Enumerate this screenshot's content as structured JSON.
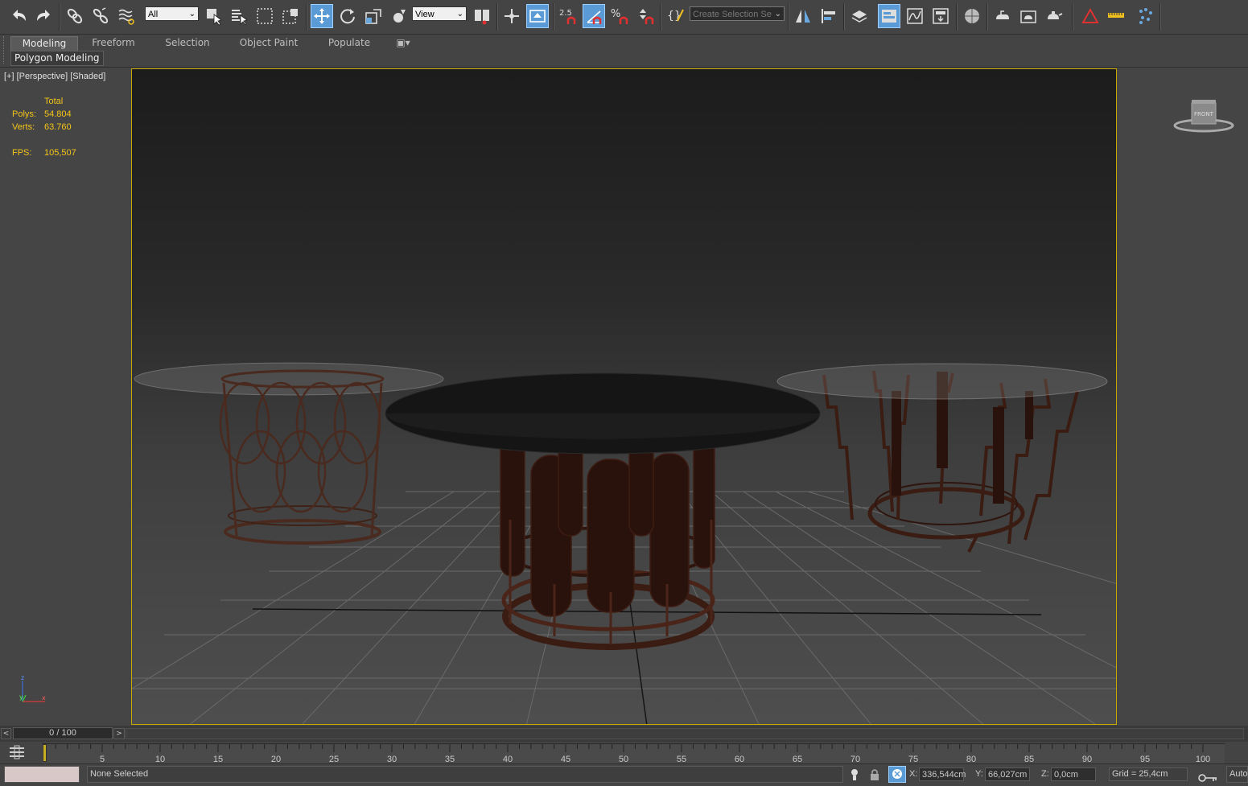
{
  "toolbar": {
    "filter_dropdown": "All",
    "coord_dropdown": "View",
    "snap_label": "2.5",
    "selection_set_placeholder": "Create Selection Se",
    "icons": [
      "undo-icon",
      "redo-icon",
      "link-icon",
      "unlink-icon",
      "bind-spacewarp-icon",
      "select-object-icon",
      "select-by-name-icon",
      "rect-select-icon",
      "window-crossing-icon",
      "move-icon",
      "rotate-icon",
      "scale-icon",
      "place-icon",
      "use-pivot-icon",
      "select-manipulate-icon",
      "keyboard-shortcut-icon",
      "snap-toggle-icon",
      "angle-snap-icon",
      "percent-snap-icon",
      "spinner-snap-icon",
      "edit-named-sets-icon",
      "mirror-icon",
      "align-icon",
      "scene-explorer-icon",
      "layer-explorer-icon",
      "curve-editor-icon",
      "schematic-view-icon",
      "material-editor-icon",
      "render-setup-icon",
      "rendered-frame-icon",
      "render-icon",
      "ruler-icon",
      "civil-view-icon",
      "particle-icon"
    ],
    "accent_color": "#5b9bd5"
  },
  "ribbon": {
    "tabs": [
      "Modeling",
      "Freeform",
      "Selection",
      "Object Paint",
      "Populate"
    ],
    "active_tab": "Modeling",
    "sub_label": "Polygon Modeling"
  },
  "viewport": {
    "label": "[+] [Perspective] [Shaded]",
    "stats": {
      "header": "Total",
      "polys_label": "Polys:",
      "polys_value": "54.804",
      "verts_label": "Verts:",
      "verts_value": "63.760",
      "fps_label": "FPS:",
      "fps_value": "105,507"
    },
    "viewcube_label": "FRONT",
    "axis": {
      "z": "z",
      "x": "x",
      "y": "y"
    }
  },
  "timeline": {
    "frame_display": "0 / 100",
    "ticks": [
      "5",
      "10",
      "15",
      "20",
      "25",
      "30",
      "35",
      "40",
      "45",
      "50",
      "55",
      "60",
      "65",
      "70",
      "75",
      "80",
      "85",
      "90",
      "95",
      "100"
    ]
  },
  "status": {
    "selection_text": "None Selected",
    "x_label": "X:",
    "x_value": "336,544cm",
    "y_label": "Y:",
    "y_value": "66,027cm",
    "z_label": "Z:",
    "z_value": "0,0cm",
    "grid_text": "Grid = 25,4cm",
    "auto_label": "Auto"
  }
}
